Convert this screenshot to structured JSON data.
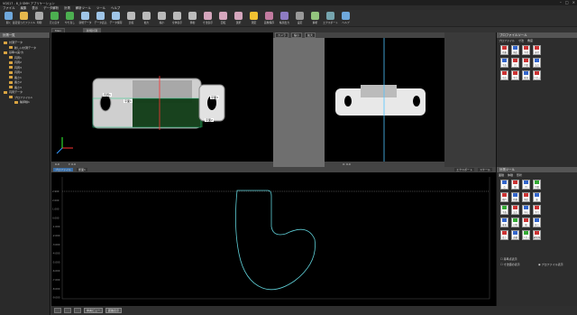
{
  "window": {
    "title": "VGS17 - 8_0 SMH アプリケーション"
  },
  "menu": [
    "ファイル",
    "編集",
    "表示",
    "データ解析",
    "計測",
    "解析ツール",
    "ツール",
    "ヘルプ"
  ],
  "toolbar": [
    "開く",
    "最近使ったファイル",
    "印刷",
    "元に戻す",
    "やり直し",
    "新規データ",
    "データ読込",
    "データ保存",
    "比較",
    "拡大",
    "縮小",
    "全体表示",
    "移動",
    "寸法表示",
    "回転",
    "選択",
    "測定",
    "画像保存",
    "帳票出力",
    "設定",
    "解析",
    "エクスポート",
    "ヘルプ"
  ],
  "doc_tabs": [
    "Main",
    "新規計測"
  ],
  "tree": {
    "title": "計測一覧",
    "items": [
      "計測データ",
      "新しい計測データ",
      "基準1(実寸)",
      "円周1",
      "円周2",
      "円周3",
      "円周4",
      "長さ1",
      "長さ2",
      "長さ3",
      "円周データ",
      "プロファイル1",
      "輪郭線1"
    ]
  },
  "view_left": {
    "labels": [
      "円周1",
      "平面1",
      "平面2",
      "平面3"
    ],
    "status": [
      "0.0",
      "Y: 0.0"
    ]
  },
  "view_right": {
    "buttons": [
      "カメラ",
      "縮小",
      "拡大"
    ],
    "status": "X: 0.0"
  },
  "profile_panel": {
    "tabs": [
      "プロファイル",
      "断面1",
      "断面表示"
    ],
    "buttons": [
      "エクスポート",
      "表示",
      "スケール"
    ],
    "y_ticks": [
      "2.900",
      "2.000",
      "1.000",
      "0.000",
      "-1.000",
      "-2.000",
      "-3.000",
      "-4.000",
      "-5.000",
      "-6.000",
      "-7.000",
      "-8.000",
      "-9.000"
    ]
  },
  "right_top": {
    "title": "プロファイルツール",
    "tabs": [
      "プロファイル",
      "寸法",
      "角度"
    ],
    "tools": [
      "距離",
      "角度",
      "半径",
      "直径",
      "平面",
      "円",
      "円弧",
      "交点",
      "中点",
      "平行",
      "垂直",
      "オフセット"
    ]
  },
  "right_bottom": {
    "title": "計測ツール",
    "tabs": [
      "面積",
      "体積",
      "形状"
    ],
    "tools": [
      "点",
      "線",
      "円",
      "円弧",
      "楕円",
      "距離",
      "角度",
      "面",
      "平面",
      "交点",
      "中心",
      "平行",
      "垂直",
      "対称",
      "幅",
      "高さ",
      "長さ",
      "面積",
      "オフセット",
      "補助線"
    ],
    "options": [
      "基準点表示",
      "寸法値の表示",
      "プロファイル表示"
    ]
  },
  "statusbar": {
    "btn1": "中央ビュー",
    "btn2": "距離表示"
  },
  "colors": {
    "accent": "#4fc3ff",
    "profile": "#5fd0d8",
    "folder": "#d9a441"
  }
}
